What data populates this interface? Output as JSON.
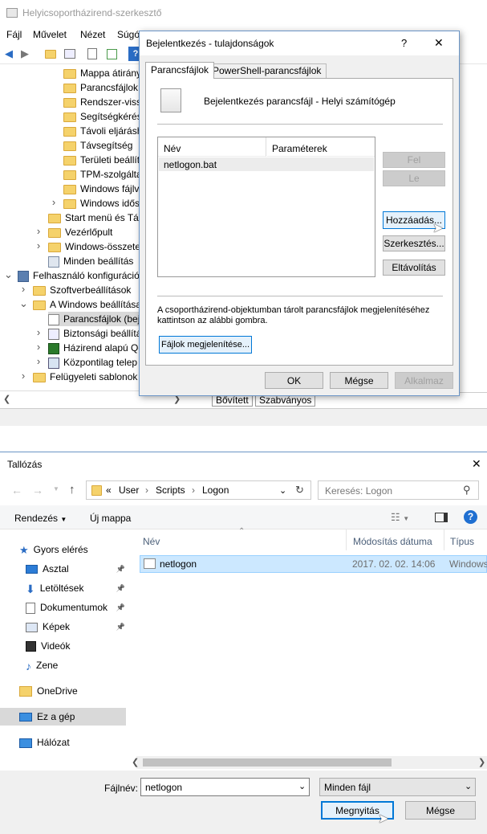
{
  "mmc": {
    "title": "Helyicsoportházirend-szerkesztő",
    "menu": [
      "Fájl",
      "Művelet",
      "Nézet",
      "Súgó"
    ],
    "tree": [
      {
        "label": "Mappa átirány",
        "indent": 3,
        "expander": ""
      },
      {
        "label": "Parancsfájlok",
        "indent": 3,
        "expander": ""
      },
      {
        "label": "Rendszer-vissz",
        "indent": 3,
        "expander": ""
      },
      {
        "label": "Segítségkérés",
        "indent": 3,
        "expander": ""
      },
      {
        "label": "Távoli eljárásh",
        "indent": 3,
        "expander": ""
      },
      {
        "label": "Távsegítség",
        "indent": 3,
        "expander": ""
      },
      {
        "label": "Területi beállít",
        "indent": 3,
        "expander": ""
      },
      {
        "label": "TPM-szolgálta",
        "indent": 3,
        "expander": ""
      },
      {
        "label": "Windows fájlv",
        "indent": 3,
        "expander": ""
      },
      {
        "label": "Windows idős",
        "indent": 3,
        "expander": ">"
      },
      {
        "label": "Start menü és Tálc",
        "indent": 2,
        "expander": ""
      },
      {
        "label": "Vezérlőpult",
        "indent": 2,
        "expander": ">"
      },
      {
        "label": "Windows-összetev",
        "indent": 2,
        "expander": ">"
      },
      {
        "label": "Minden beállítás",
        "indent": 2,
        "expander": "",
        "icon": "settings"
      },
      {
        "label": "Felhasználó konfiguráció",
        "indent": 0,
        "expander": "v",
        "icon": "user"
      },
      {
        "label": "Szoftverbeállítások",
        "indent": 1,
        "expander": ">"
      },
      {
        "label": "A Windows beállítása",
        "indent": 1,
        "expander": "v"
      },
      {
        "label": "Parancsfájlok (bej",
        "indent": 2,
        "expander": "",
        "icon": "script",
        "selected": true
      },
      {
        "label": "Biztonsági beállítá",
        "indent": 2,
        "expander": ">",
        "icon": "shield"
      },
      {
        "label": "Házirend alapú Qo",
        "indent": 2,
        "expander": ">",
        "icon": "chart"
      },
      {
        "label": "Központilag telep",
        "indent": 2,
        "expander": ">",
        "icon": "net"
      },
      {
        "label": "Felügyeleti sablonok",
        "indent": 1,
        "expander": ">"
      }
    ],
    "tabs": [
      "Bővített",
      "Szabványos"
    ]
  },
  "props": {
    "title": "Bejelentkezés - tulajdonságok",
    "help": "?",
    "close": "✕",
    "tabs": [
      "Parancsfájlok",
      "PowerShell-parancsfájlok"
    ],
    "heading": "Bejelentkezés parancsfájl - Helyi számítógép",
    "col_name": "Név",
    "col_params": "Paraméterek",
    "rows": [
      {
        "name": "netlogon.bat",
        "params": ""
      }
    ],
    "btn_up": "Fel",
    "btn_down": "Le",
    "btn_add": "Hozzáadás...",
    "btn_edit": "Szerkesztés...",
    "btn_remove": "Eltávolítás",
    "info": "A csoportházirend-objektumban tárolt parancsfájlok megjelenítéséhez kattintson az alábbi gombra.",
    "btn_show": "Fájlok megjelenítése...",
    "btn_ok": "OK",
    "btn_cancel": "Mégse",
    "btn_apply": "Alkalmaz"
  },
  "browse": {
    "title": "Tallózás",
    "close": "✕",
    "path": [
      "«",
      "User",
      "Scripts",
      "Logon"
    ],
    "search_placeholder": "Keresés: Logon",
    "organize": "Rendezés",
    "new_folder": "Új mappa",
    "nav": [
      {
        "label": "Gyors elérés",
        "icon": "star",
        "pin": false,
        "indent": 0
      },
      {
        "label": "Asztal",
        "icon": "desktop",
        "pin": true,
        "indent": 1
      },
      {
        "label": "Letöltések",
        "icon": "download",
        "pin": true,
        "indent": 1
      },
      {
        "label": "Dokumentumok",
        "icon": "doc",
        "pin": true,
        "indent": 1
      },
      {
        "label": "Képek",
        "icon": "pictures",
        "pin": true,
        "indent": 1
      },
      {
        "label": "Videók",
        "icon": "video",
        "pin": false,
        "indent": 1
      },
      {
        "label": "Zene",
        "icon": "music",
        "pin": false,
        "indent": 1
      },
      {
        "label": "OneDrive",
        "icon": "folder",
        "pin": false,
        "indent": 0
      },
      {
        "label": "Ez a gép",
        "icon": "pc",
        "pin": false,
        "indent": 0,
        "selected": true
      },
      {
        "label": "Hálózat",
        "icon": "network",
        "pin": false,
        "indent": 0
      }
    ],
    "columns": [
      "Név",
      "Módosítás dátuma",
      "Típus"
    ],
    "files": [
      {
        "name": "netlogon",
        "date": "2017. 02. 02. 14:06",
        "type": "Windows"
      }
    ],
    "filename_label": "Fájlnév:",
    "filename_value": "netlogon",
    "filter": "Minden fájl",
    "btn_open": "Megnyitás",
    "btn_cancel": "Mégse"
  },
  "colors": {
    "accent": "#0078d7",
    "selection": "#cce8ff",
    "folder": "#f5d26b"
  }
}
